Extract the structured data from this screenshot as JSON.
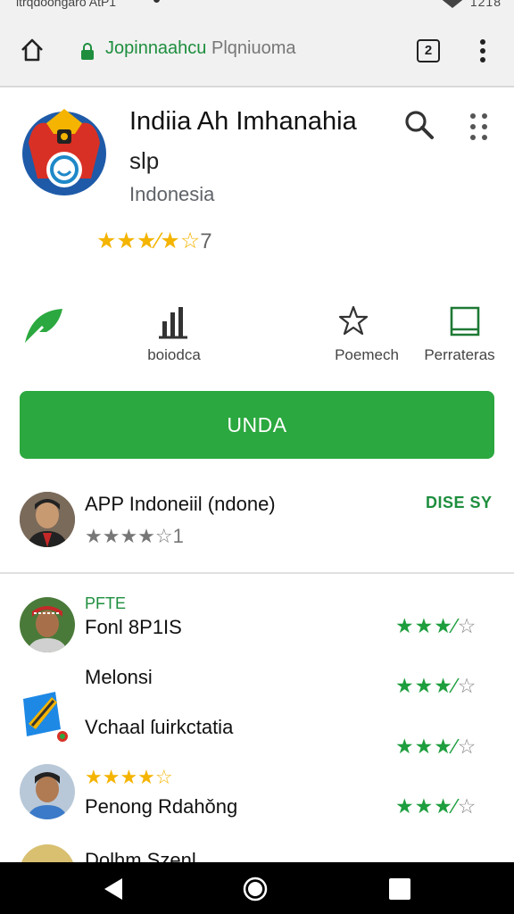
{
  "status_bar": {
    "left_text": "ltrqdoongaro AtP1",
    "right_text": "1218"
  },
  "browser": {
    "url_primary": "Jopinnaahcu",
    "url_secondary": "Plqniuoma",
    "tab_count": "2"
  },
  "app": {
    "title": "Indiia Ah Imhanahia",
    "subtitle": "slp",
    "country": "Indonesia",
    "rating_stars": "★★★⁄★☆",
    "rating_count": "7"
  },
  "actions": [
    {
      "label": ""
    },
    {
      "label": "boiodca"
    },
    {
      "label": "Poemech"
    },
    {
      "label": "Perrateras"
    }
  ],
  "install_label": "UNDA",
  "developer": {
    "name": "APP Indoneiil (ndone)",
    "stars": "★★★★☆",
    "count": "1",
    "action": "DISE SY"
  },
  "reviews": [
    {
      "tag": "PFTE",
      "text": "Fonl 8P1IS",
      "stars": "★★★",
      "half": "⁄",
      "empty": "☆"
    },
    {
      "text": "Melonsi",
      "stars": "★★★",
      "half": "⁄",
      "empty": "☆"
    },
    {
      "text": "Vchaal ſuirkctatia",
      "stars": "★★★",
      "half": "⁄",
      "empty": "☆"
    },
    {
      "rating_stars": "★★★★☆",
      "text": "Penong Rdahǒng",
      "stars": "★★★",
      "half": "⁄",
      "empty": "☆"
    },
    {
      "text": "Dolhm Szenl"
    }
  ],
  "colors": {
    "accent_green": "#2ba83f",
    "star_yellow": "#f4b400",
    "star_green": "#1e9e3e"
  }
}
